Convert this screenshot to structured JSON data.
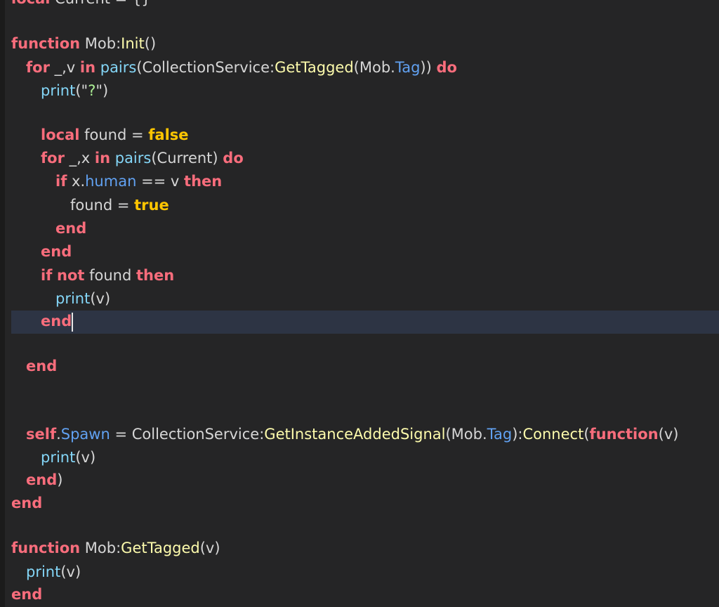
{
  "lines": [
    {
      "tokens": [
        {
          "t": "local",
          "c": "kw"
        },
        {
          "t": " Current = {}",
          "c": "plain"
        }
      ]
    },
    {
      "tokens": [
        {
          "t": "function",
          "c": "kw"
        },
        {
          "t": " Mob:",
          "c": "plain"
        },
        {
          "t": "Init",
          "c": "fn"
        },
        {
          "t": "()",
          "c": "plain"
        }
      ]
    },
    {
      "tokens": [
        {
          "t": "for",
          "c": "kw"
        },
        {
          "t": " _,v ",
          "c": "plain"
        },
        {
          "t": "in",
          "c": "kw"
        },
        {
          "t": " ",
          "c": "plain"
        },
        {
          "t": "pairs",
          "c": "builtin"
        },
        {
          "t": "(CollectionService:",
          "c": "plain"
        },
        {
          "t": "GetTagged",
          "c": "fn"
        },
        {
          "t": "(Mob.",
          "c": "plain"
        },
        {
          "t": "Tag",
          "c": "prop"
        },
        {
          "t": ")) ",
          "c": "plain"
        },
        {
          "t": "do",
          "c": "kw"
        }
      ]
    },
    {
      "tokens": [
        {
          "t": "print",
          "c": "builtin"
        },
        {
          "t": "(\"",
          "c": "plain"
        },
        {
          "t": "?",
          "c": "str"
        },
        {
          "t": "\")",
          "c": "plain"
        }
      ]
    },
    {
      "tokens": [
        {
          "t": "local",
          "c": "kw"
        },
        {
          "t": " found = ",
          "c": "plain"
        },
        {
          "t": "false",
          "c": "bool"
        }
      ]
    },
    {
      "tokens": [
        {
          "t": "for",
          "c": "kw"
        },
        {
          "t": " _,x ",
          "c": "plain"
        },
        {
          "t": "in",
          "c": "kw"
        },
        {
          "t": " ",
          "c": "plain"
        },
        {
          "t": "pairs",
          "c": "builtin"
        },
        {
          "t": "(Current) ",
          "c": "plain"
        },
        {
          "t": "do",
          "c": "kw"
        }
      ]
    },
    {
      "tokens": [
        {
          "t": "if",
          "c": "kw"
        },
        {
          "t": " x.",
          "c": "plain"
        },
        {
          "t": "human",
          "c": "prop"
        },
        {
          "t": " == v ",
          "c": "plain"
        },
        {
          "t": "then",
          "c": "kw"
        }
      ]
    },
    {
      "tokens": [
        {
          "t": "found = ",
          "c": "plain"
        },
        {
          "t": "true",
          "c": "bool"
        }
      ]
    },
    {
      "tokens": [
        {
          "t": "end",
          "c": "kw"
        }
      ]
    },
    {
      "tokens": [
        {
          "t": "end",
          "c": "kw"
        }
      ]
    },
    {
      "tokens": [
        {
          "t": "if",
          "c": "kw"
        },
        {
          "t": " ",
          "c": "plain"
        },
        {
          "t": "not",
          "c": "kw"
        },
        {
          "t": " found ",
          "c": "plain"
        },
        {
          "t": "then",
          "c": "kw"
        }
      ]
    },
    {
      "tokens": [
        {
          "t": "print",
          "c": "builtin"
        },
        {
          "t": "(v)",
          "c": "plain"
        }
      ]
    },
    {
      "tokens": [
        {
          "t": "end",
          "c": "kw"
        }
      ]
    },
    {
      "tokens": [
        {
          "t": "end",
          "c": "kw"
        }
      ]
    },
    {
      "tokens": [
        {
          "t": "self",
          "c": "kw"
        },
        {
          "t": ".",
          "c": "plain"
        },
        {
          "t": "Spawn",
          "c": "prop"
        },
        {
          "t": " = CollectionService:",
          "c": "plain"
        },
        {
          "t": "GetInstanceAddedSignal",
          "c": "fn"
        },
        {
          "t": "(Mob.",
          "c": "plain"
        },
        {
          "t": "Tag",
          "c": "prop"
        },
        {
          "t": "):",
          "c": "plain"
        },
        {
          "t": "Connect",
          "c": "fn"
        },
        {
          "t": "(",
          "c": "plain"
        },
        {
          "t": "function",
          "c": "kw"
        },
        {
          "t": "(v)",
          "c": "plain"
        }
      ]
    },
    {
      "tokens": [
        {
          "t": "print",
          "c": "builtin"
        },
        {
          "t": "(v)",
          "c": "plain"
        }
      ]
    },
    {
      "tokens": [
        {
          "t": "end",
          "c": "kw"
        },
        {
          "t": ")",
          "c": "plain"
        }
      ]
    },
    {
      "tokens": [
        {
          "t": "end",
          "c": "kw"
        }
      ]
    },
    {
      "tokens": [
        {
          "t": "function",
          "c": "kw"
        },
        {
          "t": " Mob:",
          "c": "plain"
        },
        {
          "t": "GetTagged",
          "c": "fn"
        },
        {
          "t": "(v)",
          "c": "plain"
        }
      ]
    },
    {
      "tokens": [
        {
          "t": "print",
          "c": "builtin"
        },
        {
          "t": "(v)",
          "c": "plain"
        }
      ]
    },
    {
      "tokens": [
        {
          "t": "end",
          "c": "kw"
        }
      ]
    }
  ],
  "colors": {
    "background": "#252526",
    "current_line": "#2d3444",
    "keyword": "#f86d7c",
    "boolean": "#ffc600",
    "function": "#fdfbac",
    "builtin": "#84d6f7",
    "property": "#61a1f1",
    "string": "#adf195",
    "text": "#d6d6d6"
  }
}
